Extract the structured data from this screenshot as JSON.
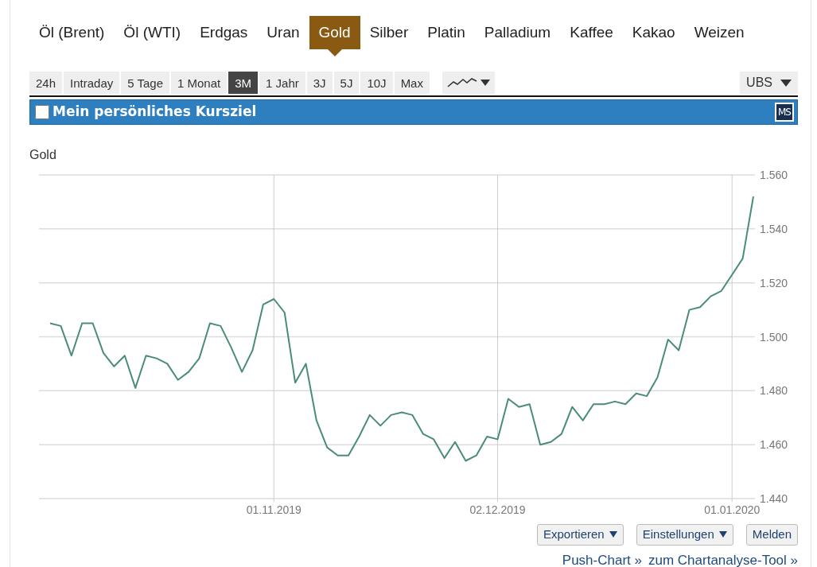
{
  "commodity_tabs": [
    {
      "label": "Öl (Brent)",
      "selected": false
    },
    {
      "label": "Öl (WTI)",
      "selected": false
    },
    {
      "label": "Erdgas",
      "selected": false
    },
    {
      "label": "Uran",
      "selected": false
    },
    {
      "label": "Gold",
      "selected": true
    },
    {
      "label": "Silber",
      "selected": false
    },
    {
      "label": "Platin",
      "selected": false
    },
    {
      "label": "Palladium",
      "selected": false
    },
    {
      "label": "Kaffee",
      "selected": false
    },
    {
      "label": "Kakao",
      "selected": false
    },
    {
      "label": "Weizen",
      "selected": false
    }
  ],
  "periods": [
    {
      "label": "24h",
      "selected": false
    },
    {
      "label": "Intraday",
      "selected": false
    },
    {
      "label": "5 Tage",
      "selected": false
    },
    {
      "label": "1 Monat",
      "selected": false
    },
    {
      "label": "3M",
      "selected": true
    },
    {
      "label": "1 Jahr",
      "selected": false
    },
    {
      "label": "3J",
      "selected": false
    },
    {
      "label": "5J",
      "selected": false
    },
    {
      "label": "10J",
      "selected": false
    },
    {
      "label": "Max",
      "selected": false
    }
  ],
  "source_menu": {
    "label": "UBS"
  },
  "kursziel": {
    "label": "Mein persönliches Kursziel",
    "checked": false,
    "badge": "MS"
  },
  "chart": {
    "title": "Gold",
    "chart_data": {
      "type": "line",
      "categories": [
        null,
        null,
        null,
        null,
        null,
        null,
        null,
        null,
        null,
        null,
        null,
        null,
        null,
        null,
        null,
        null,
        null,
        null,
        null,
        null,
        null,
        "01.11.2019",
        null,
        null,
        null,
        null,
        null,
        null,
        null,
        null,
        null,
        null,
        null,
        null,
        null,
        null,
        null,
        null,
        null,
        null,
        null,
        null,
        "02.12.2019",
        null,
        null,
        null,
        null,
        null,
        null,
        null,
        null,
        null,
        null,
        null,
        null,
        null,
        null,
        null,
        null,
        null,
        null,
        null,
        null,
        null,
        "01.01.2020",
        null,
        null
      ],
      "series": [
        {
          "color": "#4a8c78",
          "values": [
            1505,
            1504,
            1493,
            1505,
            1505,
            1494,
            1489,
            1493,
            1481,
            1493,
            1492,
            1490,
            1484,
            1487,
            1492,
            1505,
            1504,
            1496,
            1487,
            1495,
            1512,
            1514,
            1509,
            1483,
            1490,
            1469,
            1459,
            1456,
            1456,
            1463,
            1471,
            1467,
            1471,
            1472,
            1471,
            1464,
            1462,
            1455,
            1461,
            1454,
            1456,
            1463,
            1462,
            1477,
            1474,
            1475,
            1460,
            1461,
            1464,
            1474,
            1469,
            1475,
            1475,
            1476,
            1475,
            1479,
            1478,
            1485,
            1499,
            1495,
            1510,
            1511,
            1515,
            1517,
            1523,
            1529,
            1552
          ]
        }
      ],
      "ylim": [
        1440,
        1560
      ],
      "grid": true,
      "yticks": [
        {
          "value": 1440,
          "label": "1.440"
        },
        {
          "value": 1460,
          "label": "1.460"
        },
        {
          "value": 1480,
          "label": "1.480"
        },
        {
          "value": 1500,
          "label": "1.500"
        },
        {
          "value": 1520,
          "label": "1.520"
        },
        {
          "value": 1540,
          "label": "1.540"
        },
        {
          "value": 1560,
          "label": "1.560"
        }
      ]
    }
  },
  "buttons": [
    {
      "label": "Exportieren",
      "kind": "dropdown"
    },
    {
      "label": "Einstellungen",
      "kind": "dropdown"
    },
    {
      "label": "Melden",
      "kind": "plain"
    }
  ],
  "links": [
    "Push-Chart »",
    "zum Chartanalyse-Tool »"
  ]
}
